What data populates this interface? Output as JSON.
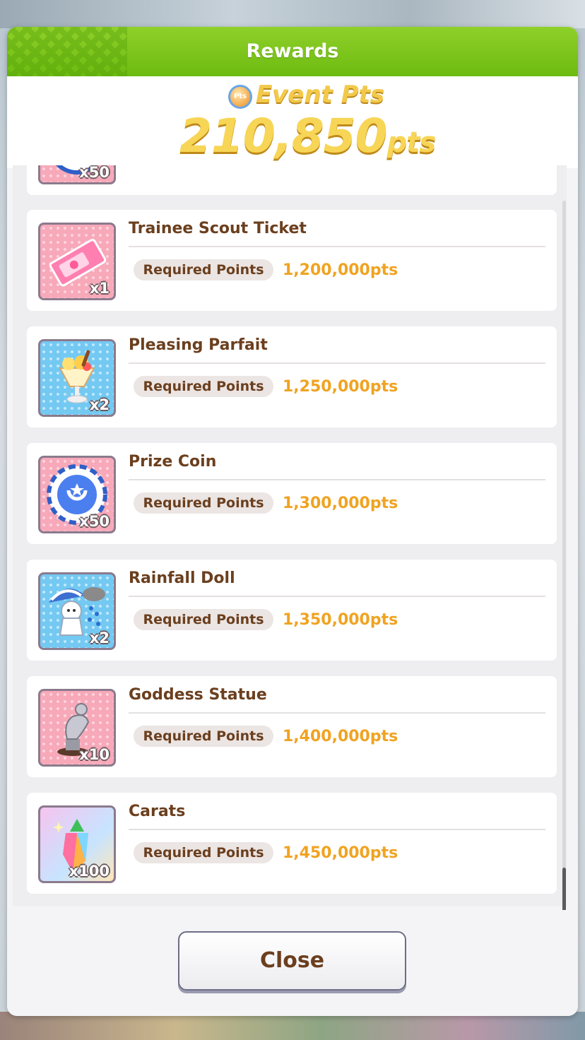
{
  "header": {
    "title": "Rewards"
  },
  "points": {
    "badge": "Pts",
    "label": "Event Pts",
    "value": "210,850",
    "unit": "pts"
  },
  "items": [
    {
      "name": "",
      "qty": "x50",
      "required_label": "",
      "required_value": "",
      "icon": "prize-coin-icon",
      "bg": "pink"
    },
    {
      "name": "Trainee Scout Ticket",
      "qty": "x1",
      "required_label": "Required Points",
      "required_value": "1,200,000pts",
      "icon": "ticket-icon",
      "bg": "pink"
    },
    {
      "name": "Pleasing Parfait",
      "qty": "x2",
      "required_label": "Required Points",
      "required_value": "1,250,000pts",
      "icon": "parfait-icon",
      "bg": "blue"
    },
    {
      "name": "Prize Coin",
      "qty": "x50",
      "required_label": "Required Points",
      "required_value": "1,300,000pts",
      "icon": "prize-coin-icon",
      "bg": "pink"
    },
    {
      "name": "Rainfall Doll",
      "qty": "x2",
      "required_label": "Required Points",
      "required_value": "1,350,000pts",
      "icon": "rain-doll-icon",
      "bg": "blue"
    },
    {
      "name": "Goddess Statue",
      "qty": "x10",
      "required_label": "Required Points",
      "required_value": "1,400,000pts",
      "icon": "statue-icon",
      "bg": "pink"
    },
    {
      "name": "Carats",
      "qty": "x100",
      "required_label": "Required Points",
      "required_value": "1,450,000pts",
      "icon": "carat-crystal-icon",
      "bg": "rainbow"
    }
  ],
  "footer": {
    "close_label": "Close"
  },
  "colors": {
    "header_green": "#7cc41a",
    "accent_orange": "#f0a321",
    "name_brown": "#6b3f1e"
  }
}
